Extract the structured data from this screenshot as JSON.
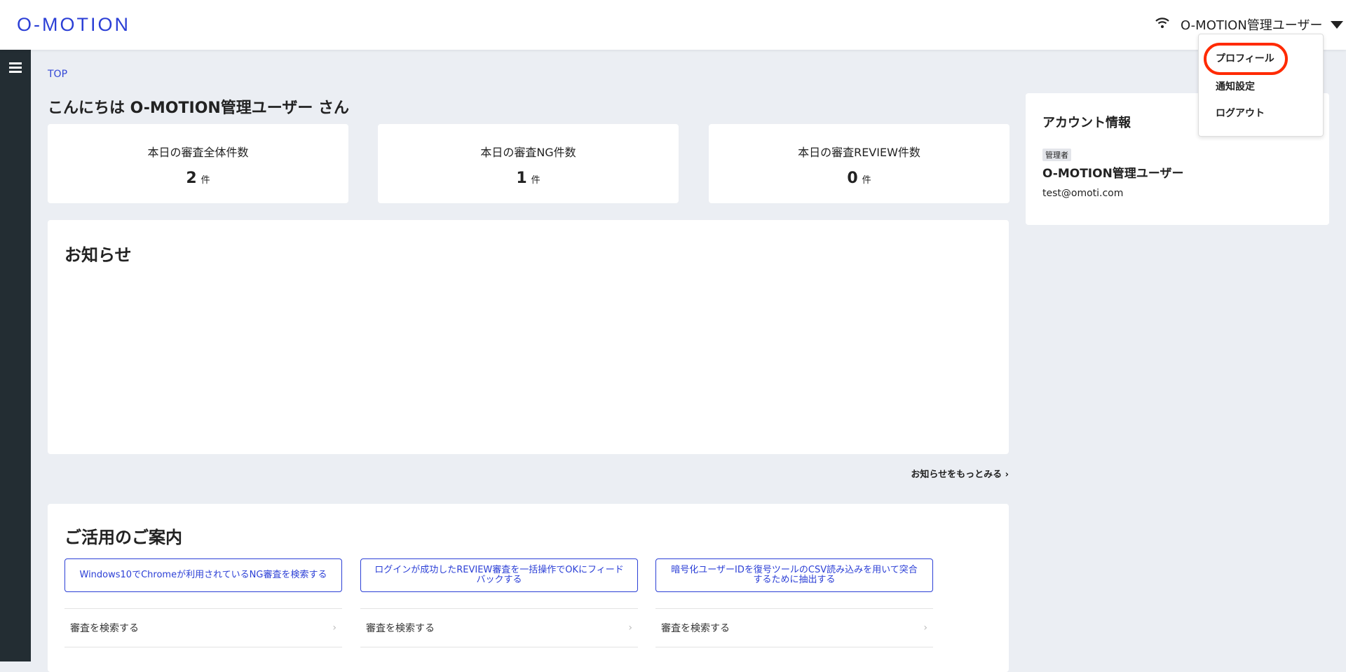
{
  "header": {
    "logo": "O-MOTION",
    "user_name": "O-MOTION管理ユーザー"
  },
  "dropdown": {
    "items": [
      "プロフィール",
      "通知設定",
      "ログアウト"
    ],
    "highlighted": "プロフィール",
    "highlight_color": "#ff2a00"
  },
  "breadcrumb": "TOP",
  "greeting": "こんにちは O-MOTION管理ユーザー さん",
  "stats": [
    {
      "label": "本日の審査全体件数",
      "value": "2",
      "unit": "件"
    },
    {
      "label": "本日の審査NG件数",
      "value": "1",
      "unit": "件"
    },
    {
      "label": "本日の審査REVIEW件数",
      "value": "0",
      "unit": "件"
    }
  ],
  "news": {
    "title": "お知らせ",
    "more": "お知らせをもっとみる"
  },
  "account": {
    "title": "アカウント情報",
    "role": "管理者",
    "name": "O-MOTION管理ユーザー",
    "email": "test@omoti.com"
  },
  "guide": {
    "title": "ご活用のご案内",
    "buttons": [
      "Windows10でChromeが利用されているNG審査を検索する",
      "ログインが成功したREVIEW審査を一括操作でOKにフィードバックする",
      "暗号化ユーザーIDを復号ツールのCSV読み込みを用いて突合するために抽出する"
    ],
    "links": [
      "審査を検索する",
      "審査を検索する",
      "審査を検索する"
    ]
  },
  "colors": {
    "accent": "#2b3fd6",
    "sidebar": "#232d33"
  }
}
